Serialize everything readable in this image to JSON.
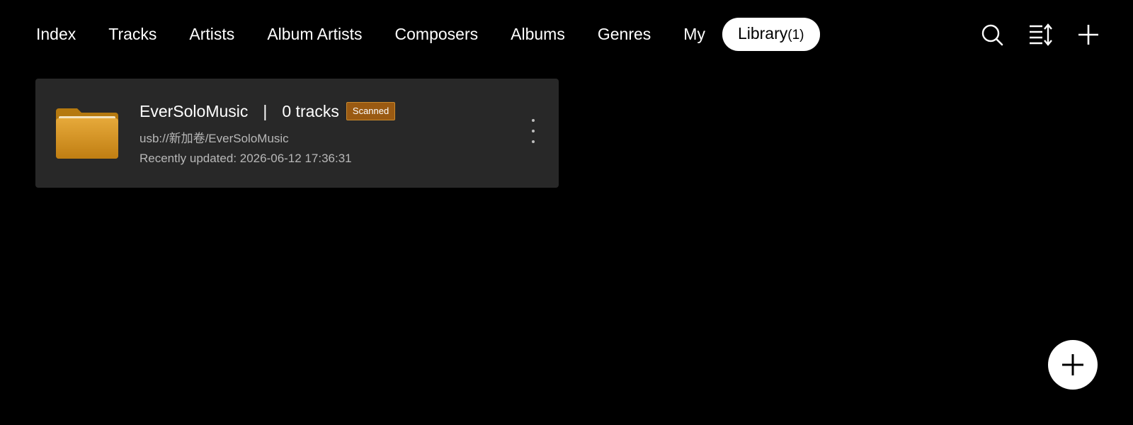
{
  "tabs": [
    {
      "label": "Index"
    },
    {
      "label": "Tracks"
    },
    {
      "label": "Artists"
    },
    {
      "label": "Album Artists"
    },
    {
      "label": "Composers"
    },
    {
      "label": "Albums"
    },
    {
      "label": "Genres"
    },
    {
      "label": "My"
    },
    {
      "label": "Library",
      "count": "(1)",
      "active": true
    }
  ],
  "toolbar": {
    "icons": [
      "search-icon",
      "sort-icon",
      "add-icon"
    ]
  },
  "library": {
    "items": [
      {
        "name": "EverSoloMusic",
        "separator": "|",
        "tracks": "0 tracks",
        "badge": "Scanned",
        "path": "usb://新加卷/EverSoloMusic",
        "updated": "Recently updated: 2026-06-12 17:36:31",
        "icon": "folder-icon"
      }
    ]
  },
  "fab": {
    "icon": "plus-icon"
  },
  "colors": {
    "background": "#000000",
    "card": "#282828",
    "badge": "#9a5a12",
    "folder": "#d9962a",
    "text_secondary": "#b8b8b8"
  }
}
